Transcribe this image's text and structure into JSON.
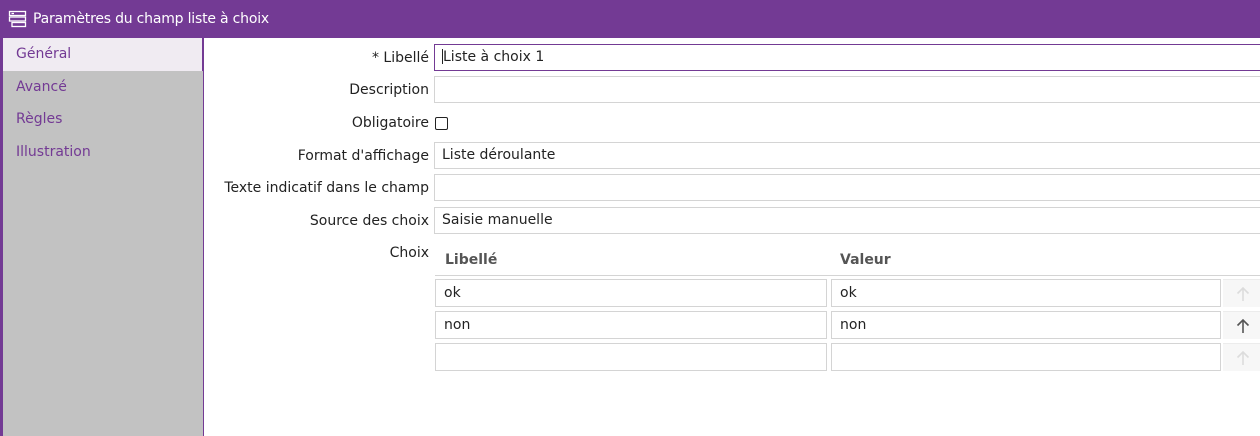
{
  "window": {
    "title": "Paramètres du champ liste à choix",
    "title_icon": "list-settings-icon"
  },
  "colors": {
    "accent": "#733a94",
    "sidebar_bg": "#c2c2c2",
    "active_bg": "#f0ebf2"
  },
  "sidebar": {
    "items": [
      {
        "label": "Général",
        "active": true
      },
      {
        "label": "Avancé",
        "active": false
      },
      {
        "label": "Règles",
        "active": false
      },
      {
        "label": "Illustration",
        "active": false
      }
    ]
  },
  "form": {
    "libelle_label": "* Libellé",
    "libelle_value": "Liste à choix 1",
    "description_label": "Description",
    "description_value": "",
    "obligatoire_label": "Obligatoire",
    "obligatoire_checked": false,
    "format_label": "Format d'affichage",
    "format_value": "Liste déroulante",
    "placeholder_label": "Texte indicatif dans le champ",
    "placeholder_value": "",
    "source_label": "Source des choix",
    "source_value": "Saisie manuelle",
    "choix_label": "Choix"
  },
  "choices": {
    "columns": [
      "Libellé",
      "Valeur"
    ],
    "rows": [
      {
        "libelle": "ok",
        "valeur": "ok",
        "arrow": "up-arrow-icon",
        "arrow_enabled": false
      },
      {
        "libelle": "non",
        "valeur": "non",
        "arrow": "up-arrow-icon",
        "arrow_enabled": true
      },
      {
        "libelle": "",
        "valeur": "",
        "arrow": "up-arrow-icon",
        "arrow_enabled": false
      }
    ]
  }
}
